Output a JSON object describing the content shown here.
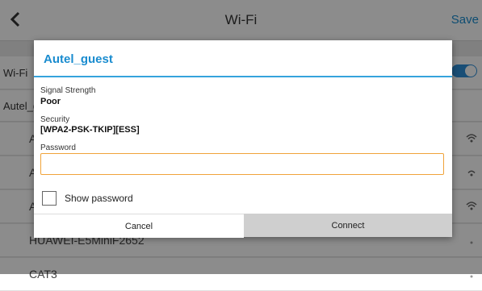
{
  "topbar": {
    "title": "Wi-Fi",
    "save_label": "Save",
    "back_icon": "chevron-left-icon"
  },
  "background": {
    "wifi_row_label": "Wi-Fi",
    "connected_row_label": "Autel_guest",
    "networks": [
      {
        "name": "A"
      },
      {
        "name": "A"
      },
      {
        "name": "A"
      },
      {
        "name": "HUAWEI-E5MiniF2652"
      },
      {
        "name": "CAT3"
      }
    ]
  },
  "dialog": {
    "title": "Autel_guest",
    "signal_label": "Signal Strength",
    "signal_value": "Poor",
    "security_label": "Security",
    "security_value": "[WPA2-PSK-TKIP][ESS]",
    "password_label": "Password",
    "password_value": "",
    "show_password_label": "Show password",
    "show_password_checked": false,
    "cancel_label": "Cancel",
    "connect_label": "Connect"
  },
  "colors": {
    "accent": "#1a8ccf",
    "divider": "#35a3dc",
    "input_focus": "#f0a33a"
  }
}
